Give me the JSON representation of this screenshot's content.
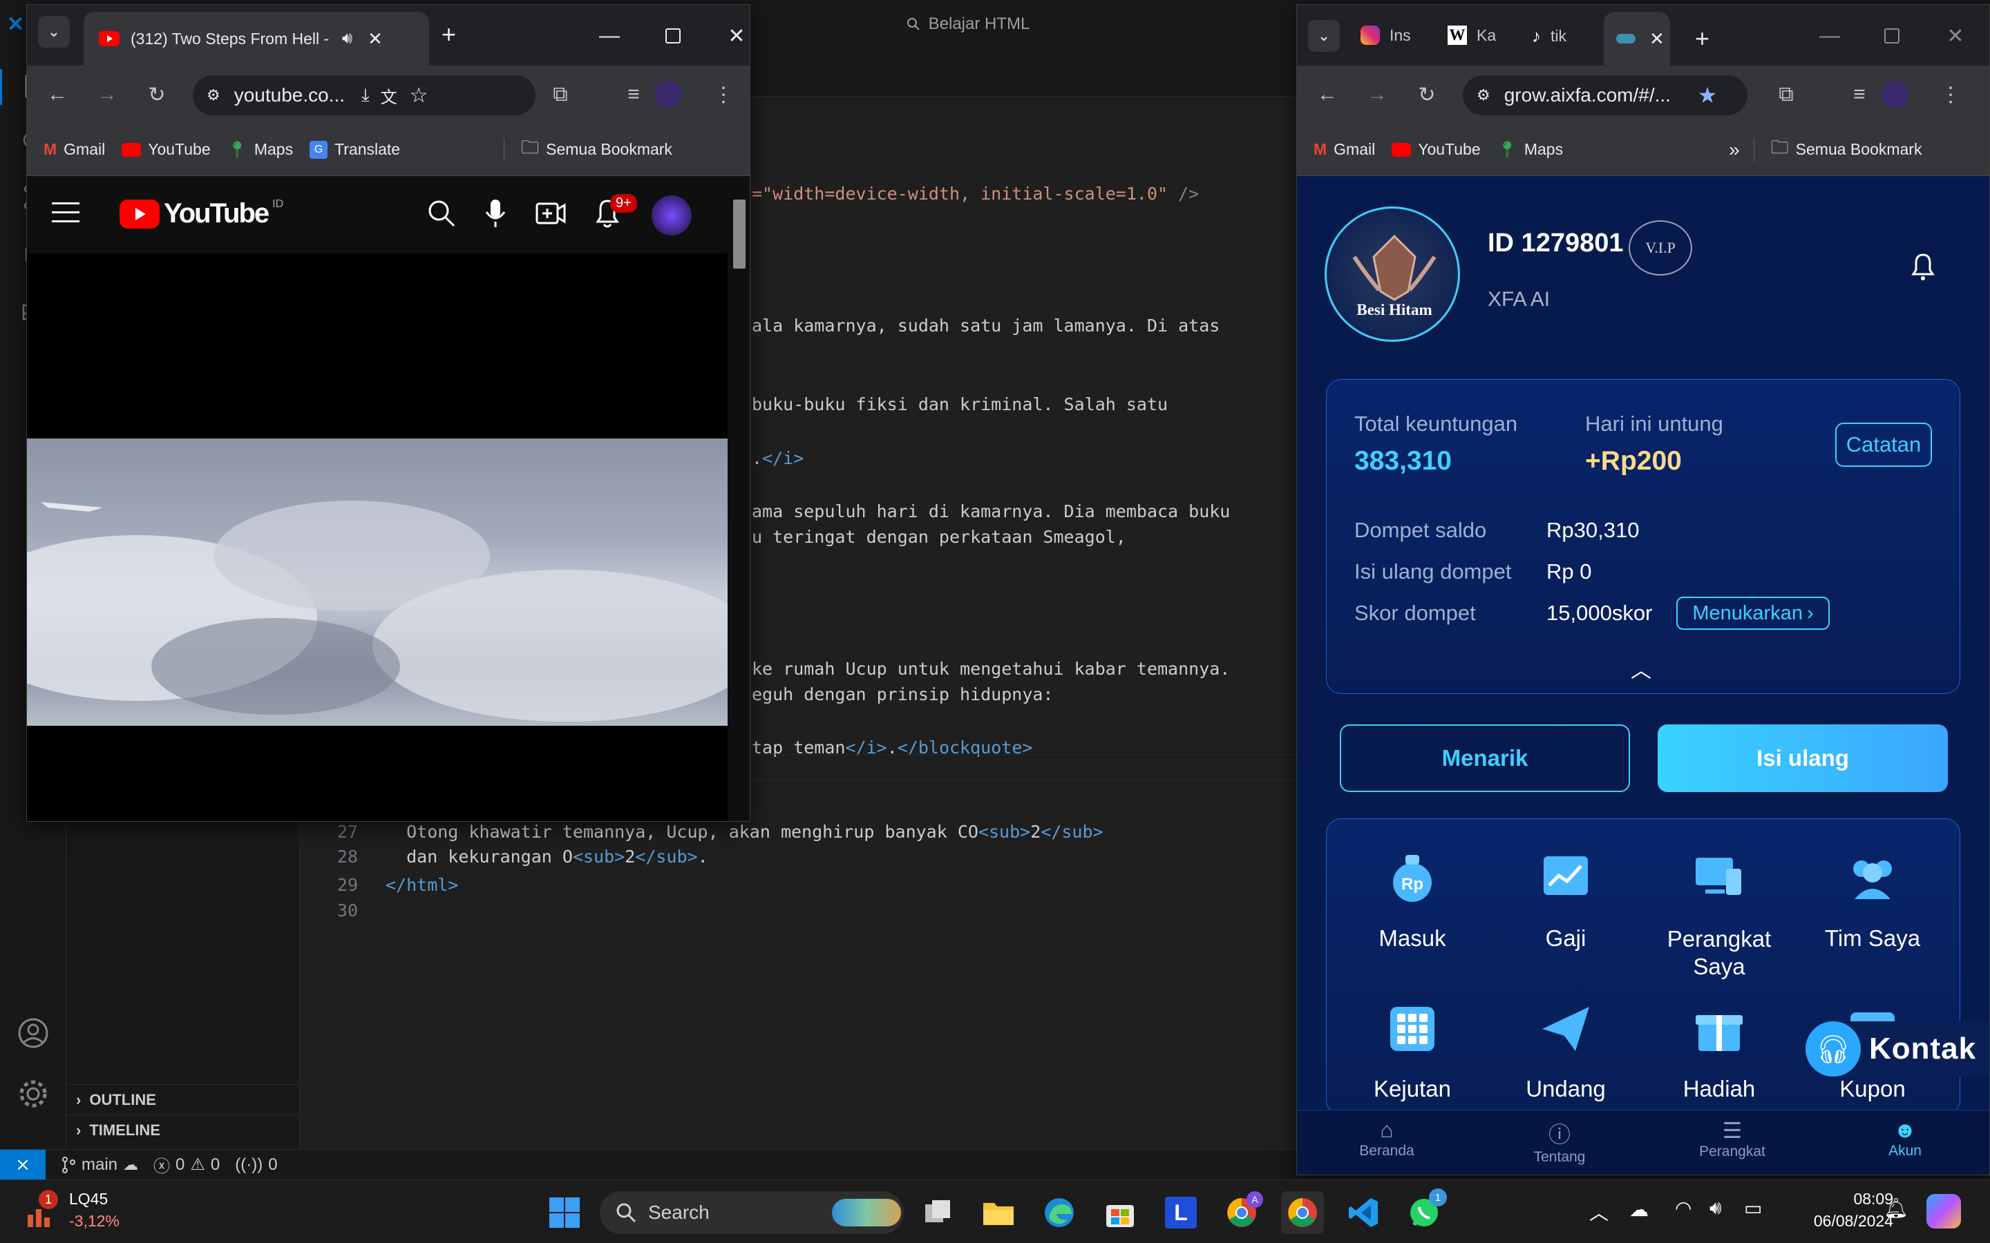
{
  "vscode": {
    "title_search": "Belajar HTML",
    "sidebar_sections": [
      "OUTLINE",
      "TIMELINE"
    ],
    "code_lines": [
      {
        "parts": [
          {
            "t": "=\"width=device-width, initial-scale=1.0\"",
            "c": "st"
          },
          {
            "t": " />",
            "c": "gr"
          }
        ]
      },
      {
        "parts": [
          {
            "t": "ala kamarnya, sudah satu jam lamanya. Di atas",
            "c": "ct0"
          }
        ]
      },
      {
        "parts": [
          {
            "t": "buku-buku fiksi dan kriminal. Salah satu",
            "c": "ct0"
          }
        ]
      },
      {
        "parts": [
          {
            "t": ".",
            "c": "ct0"
          },
          {
            "t": "</i>",
            "c": "tg"
          }
        ]
      },
      {
        "parts": [
          {
            "t": "ama sepuluh hari di kamarnya. Dia membaca buku",
            "c": "ct0"
          }
        ]
      },
      {
        "parts": [
          {
            "t": "u teringat dengan perkataan Smeagol,",
            "c": "ct0"
          }
        ]
      },
      {
        "parts": [
          {
            "t": "ke rumah Ucup untuk mengetahui kabar temannya.",
            "c": "ct0"
          }
        ]
      },
      {
        "parts": [
          {
            "t": "eguh dengan prinsip hidupnya:",
            "c": "ct0"
          }
        ]
      },
      {
        "parts": [
          {
            "t": "tap teman",
            "c": "ct0"
          },
          {
            "t": "</i>",
            "c": "tg"
          },
          {
            "t": ".",
            "c": "ct0"
          },
          {
            "t": "</blockquote>",
            "c": "tg"
          }
        ]
      }
    ],
    "lines": [
      {
        "num": "27",
        "parts": [
          {
            "t": "  Otong khawatir temannya, Ucup, akan menghirup banyak CO",
            "c": "ct0"
          },
          {
            "t": "<sub>",
            "c": "tg"
          },
          {
            "t": "2",
            "c": "ct0"
          },
          {
            "t": "</sub>",
            "c": "tg"
          }
        ]
      },
      {
        "num": "28",
        "parts": [
          {
            "t": "  dan kekurangan O",
            "c": "ct0"
          },
          {
            "t": "<sub>",
            "c": "tg"
          },
          {
            "t": "2",
            "c": "ct0"
          },
          {
            "t": "</sub>",
            "c": "tg"
          },
          {
            "t": ".",
            "c": "ct0"
          }
        ]
      },
      {
        "num": "29",
        "parts": [
          {
            "t": "</html>",
            "c": "tg"
          }
        ]
      },
      {
        "num": "30",
        "parts": []
      }
    ],
    "status": {
      "branch": "main",
      "errors": "0",
      "warnings": "0",
      "ports": "0"
    }
  },
  "youtube_window": {
    "tab_title": "(312) Two Steps From Hell -",
    "address": "youtube.co...",
    "bookmarks": [
      "Gmail",
      "YouTube",
      "Maps",
      "Translate"
    ],
    "all_bookmarks": "Semua Bookmark",
    "logo_text": "YouTube",
    "region": "ID",
    "notif_badge": "9+"
  },
  "aixfa_window": {
    "tabs": [
      "Ins",
      "Ka",
      "tik"
    ],
    "address": "grow.aixfa.com/#/...",
    "bookmarks": [
      "Gmail",
      "YouTube",
      "Maps"
    ],
    "all_bookmarks": "Semua Bookmark",
    "profile": {
      "id": "ID 1279801",
      "vip": "V.I.P",
      "name": "XFA AI",
      "rank": "Besi Hitam"
    },
    "stats": {
      "total_label": "Total keuntungan",
      "total_value": "383,310",
      "today_label": "Hari ini untung",
      "today_value": "+Rp200",
      "records_btn": "Catatan",
      "wallet_label": "Dompet saldo",
      "wallet_value": "Rp30,310",
      "topup_label": "Isi ulang dompet",
      "topup_value": "Rp 0",
      "score_label": "Skor dompet",
      "score_value": "15,000skor",
      "redeem_btn": "Menukarkan"
    },
    "withdraw_btn": "Menarik",
    "recharge_btn": "Isi ulang",
    "grid": [
      "Masuk",
      "Gaji",
      "Perangkat Saya",
      "Tim Saya",
      "Kejutan",
      "Undang",
      "Hadiah",
      "Kupon"
    ],
    "contact": "Kontak",
    "nav": [
      "Beranda",
      "Tentang",
      "Perangkat",
      "Akun"
    ],
    "colors": {
      "bg": "#061a4d",
      "accent": "#3fd0ff",
      "card_border": "#1e5fd9"
    }
  },
  "taskbar": {
    "stock_name": "LQ45",
    "stock_change": "-3,12%",
    "stock_badge": "1",
    "search": "Search",
    "time": "08:09",
    "date": "06/08/2024",
    "whatsapp_badge": "1"
  }
}
